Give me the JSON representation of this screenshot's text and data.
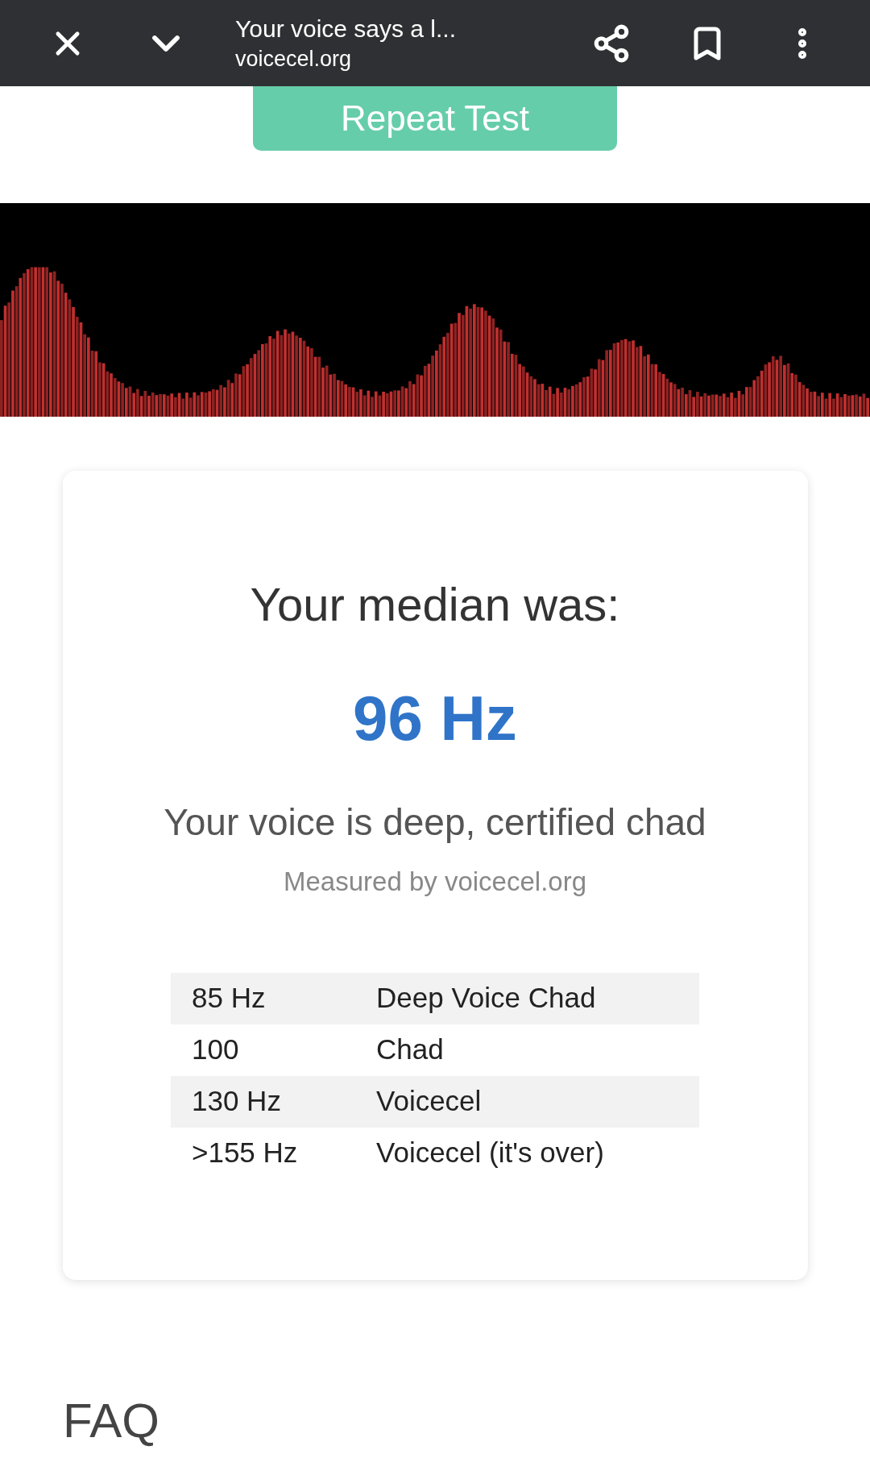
{
  "browser_bar": {
    "title": "Your voice says a l...",
    "url": "voicecel.org"
  },
  "repeat_button": {
    "label": "Repeat Test"
  },
  "result_card": {
    "heading": "Your median was:",
    "value": "96 Hz",
    "verdict": "Your voice is deep, certified chad",
    "credit": "Measured by voicecel.org",
    "table": {
      "rows": [
        {
          "frequency": "85 Hz",
          "label": "Deep Voice Chad"
        },
        {
          "frequency": "100",
          "label": "Chad"
        },
        {
          "frequency": "130 Hz",
          "label": "Voicecel"
        },
        {
          "frequency": ">155 Hz",
          "label": "Voicecel (it's over)"
        }
      ]
    }
  },
  "faq": {
    "heading": "FAQ"
  }
}
